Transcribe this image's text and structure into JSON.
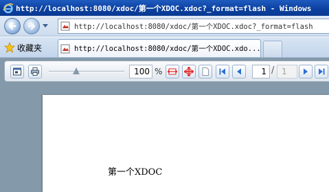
{
  "window": {
    "title": "http://localhost:8080/xdoc/第一个XDOC.xdoc?_format=flash - Windows"
  },
  "address_bar": {
    "url": "http://localhost:8080/xdoc/第一个XDOC.xdoc?_format=flash"
  },
  "favorites": {
    "label": "收藏夹"
  },
  "tab": {
    "title": "http://localhost:8080/xdoc/第一个XDOC.xdo..."
  },
  "viewer_toolbar": {
    "zoom_value": "100",
    "zoom_unit": "%",
    "zoom_level": 0.36,
    "current_page": "1",
    "page_separator": "/",
    "total_pages": "1"
  },
  "document": {
    "text": "第一个XDOC"
  },
  "colors": {
    "titlebar": "#0b3f9e",
    "viewer_bg": "#8499aa",
    "nav_blue": "#2d6fd0",
    "red_icon": "#e02020"
  }
}
